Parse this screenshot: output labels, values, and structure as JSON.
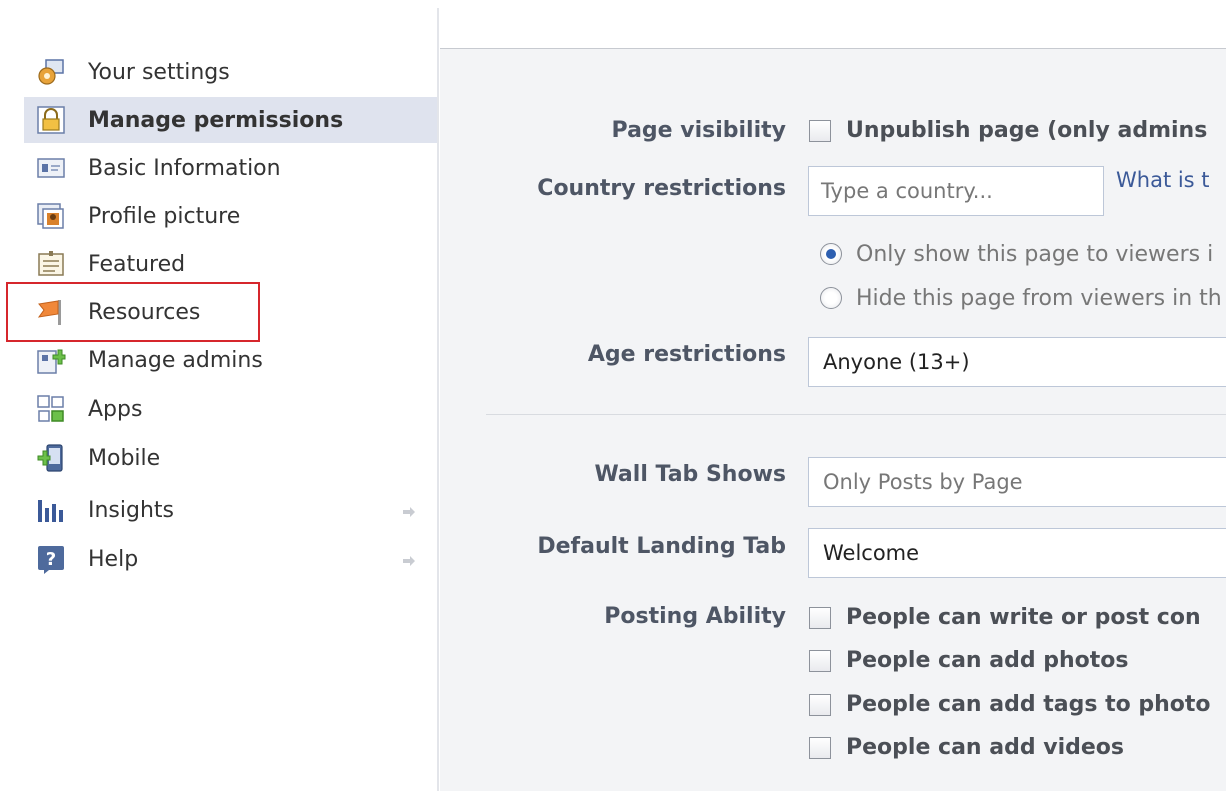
{
  "sidebar": {
    "items": [
      {
        "label": "Your settings",
        "icon": "settings-icon"
      },
      {
        "label": "Manage permissions",
        "icon": "lock-icon",
        "active": true
      },
      {
        "label": "Basic Information",
        "icon": "id-card-icon"
      },
      {
        "label": "Profile picture",
        "icon": "profile-picture-icon"
      },
      {
        "label": "Featured",
        "icon": "featured-icon"
      },
      {
        "label": "Resources",
        "icon": "flag-icon"
      },
      {
        "label": "Manage admins",
        "icon": "manage-admins-icon"
      },
      {
        "label": "Apps",
        "icon": "apps-icon"
      },
      {
        "label": "Mobile",
        "icon": "mobile-icon"
      },
      {
        "label": "Insights",
        "icon": "insights-icon"
      },
      {
        "label": "Help",
        "icon": "help-icon"
      }
    ]
  },
  "form": {
    "page_visibility": {
      "label": "Page visibility",
      "checkbox_label": "Unpublish page (only admins",
      "checked": false
    },
    "country_restrictions": {
      "label": "Country restrictions",
      "placeholder": "Type a country...",
      "help_link": "What is t",
      "option_show": "Only show this page to viewers i",
      "option_hide": "Hide this page from viewers in th",
      "selected": "show"
    },
    "age_restrictions": {
      "label": "Age restrictions",
      "value": "Anyone (13+)"
    },
    "wall_tab": {
      "label": "Wall Tab Shows",
      "value": "Only Posts by Page"
    },
    "default_landing_tab": {
      "label": "Default Landing Tab",
      "value": "Welcome"
    },
    "posting_ability": {
      "label": "Posting Ability",
      "options": [
        {
          "label": "People can write or post con",
          "checked": false
        },
        {
          "label": "People can add photos",
          "checked": false
        },
        {
          "label": "People can add tags to photo",
          "checked": false
        },
        {
          "label": "People can add videos",
          "checked": false
        }
      ]
    }
  },
  "colors": {
    "active_bg": "#dfe3ee",
    "highlight": "#d6262c",
    "link": "#3b5998",
    "main_bg": "#f3f4f6"
  }
}
